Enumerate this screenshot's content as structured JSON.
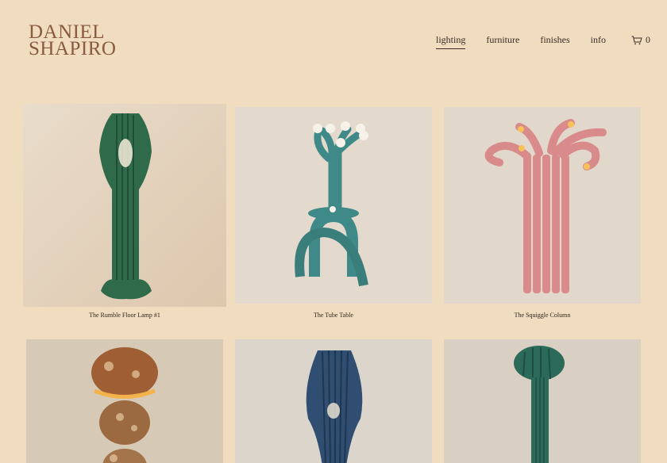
{
  "brand": {
    "line1": "DANIEL",
    "line2": "SHAPIRO"
  },
  "nav": {
    "items": [
      {
        "label": "lighting",
        "active": true
      },
      {
        "label": "furniture",
        "active": false
      },
      {
        "label": "finishes",
        "active": false
      },
      {
        "label": "info",
        "active": false
      }
    ],
    "cart_count": "0"
  },
  "products": [
    {
      "title": "The Rumble Floor Lamp #1",
      "object_color": "#2f6b4b"
    },
    {
      "title": "The Tube Table",
      "object_color": "#3f8a88"
    },
    {
      "title": "The Squiggle Column",
      "object_color": "#d98a8a"
    },
    {
      "title": "",
      "object_color": "#a05e35"
    },
    {
      "title": "",
      "object_color": "#2f4e72"
    },
    {
      "title": "",
      "object_color": "#2c6b5a"
    }
  ],
  "colors": {
    "background": "#f0dcbf",
    "logo": "#8a5a3f",
    "text": "#3b2c26"
  }
}
